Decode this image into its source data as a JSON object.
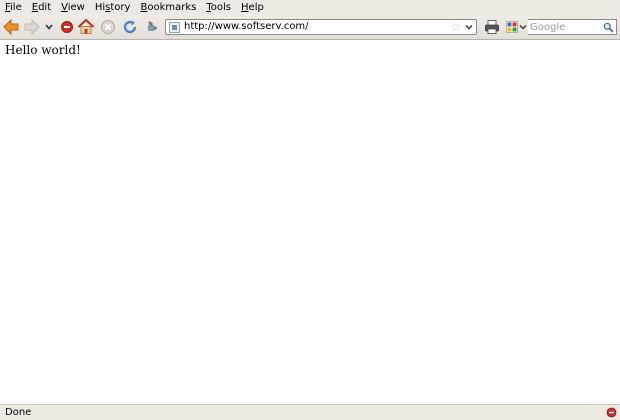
{
  "menubar": {
    "items": [
      {
        "mnemonic": "F",
        "rest": "ile"
      },
      {
        "mnemonic": "E",
        "rest": "dit"
      },
      {
        "mnemonic": "V",
        "rest": "iew"
      },
      {
        "pre": "Hi",
        "mnemonic": "s",
        "rest": "tory"
      },
      {
        "mnemonic": "B",
        "rest": "ookmarks"
      },
      {
        "mnemonic": "T",
        "rest": "ools"
      },
      {
        "mnemonic": "H",
        "rest": "elp"
      }
    ]
  },
  "toolbar": {
    "url": "http://www.softserv.com/",
    "search_placeholder": "Google"
  },
  "content": {
    "text": "Hello world!"
  },
  "statusbar": {
    "text": "Done"
  },
  "icons": {
    "back": "back-arrow-icon",
    "forward": "forward-arrow-icon",
    "history_dropdown": "chevron-down-icon",
    "stop_red": "stop-icon",
    "home": "home-icon",
    "stop": "stop-icon",
    "reload": "reload-icon",
    "addon": "puzzle-icon",
    "print": "printer-icon",
    "search_engine": "google-icon",
    "search_go": "magnifier-icon",
    "status": "adblock-icon"
  },
  "colors": {
    "chrome_bg": "#ede9e3",
    "back_arrow": "#e8922c",
    "stop_red": "#c9302c",
    "reload_blue": "#4a86c7"
  }
}
